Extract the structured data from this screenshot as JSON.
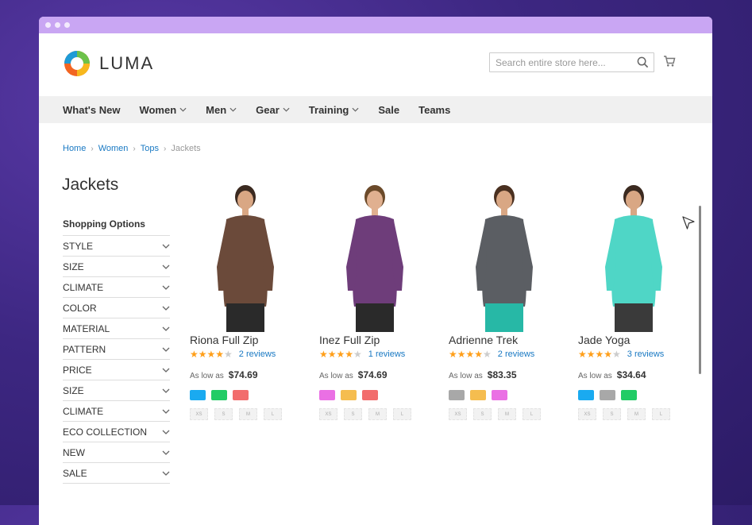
{
  "app": {
    "logo_text": "LUMA"
  },
  "search": {
    "placeholder": "Search entire store here..."
  },
  "nav": [
    {
      "label": "What's New",
      "dropdown": false
    },
    {
      "label": "Women",
      "dropdown": true
    },
    {
      "label": "Men",
      "dropdown": true
    },
    {
      "label": "Gear",
      "dropdown": true
    },
    {
      "label": "Training",
      "dropdown": true
    },
    {
      "label": "Sale",
      "dropdown": false
    },
    {
      "label": "Teams",
      "dropdown": false
    }
  ],
  "breadcrumb": {
    "home": "Home",
    "women": "Women",
    "tops": "Tops",
    "current": "Jackets"
  },
  "page_title": "Jackets",
  "sidebar": {
    "title": "Shopping Options",
    "filters": [
      "STYLE",
      "SIZE",
      "CLIMATE",
      "COLOR",
      "MATERIAL",
      "PATTERN",
      "PRICE",
      "SIZE",
      "CLIMATE",
      "ECO COLLECTION",
      "NEW",
      "SALE"
    ]
  },
  "products": [
    {
      "name": "Riona Full Zip",
      "rating_stars": 4,
      "reviews": "2 reviews",
      "price_label": "As low as",
      "price": "$74.69",
      "swatches": [
        "#1aaaf0",
        "#22cc66",
        "#f26d6d"
      ],
      "sizes": [
        "XS",
        "S",
        "M",
        "L"
      ],
      "top_color": "#6b4a3a",
      "bottom_color": "#2a2a2a",
      "skin": "#d9a784",
      "hair": "#3b2a20"
    },
    {
      "name": "Inez Full Zip",
      "rating_stars": 4,
      "reviews": "1 reviews",
      "price_label": "As low as",
      "price": "$74.69",
      "swatches": [
        "#ea70e4",
        "#f5bd4f",
        "#f26d6d"
      ],
      "sizes": [
        "XS",
        "S",
        "M",
        "L"
      ],
      "top_color": "#6e3d7a",
      "bottom_color": "#2a2a2a",
      "skin": "#e0b090",
      "hair": "#6b4a2a"
    },
    {
      "name": "Adrienne Trek",
      "rating_stars": 4,
      "reviews": "2 reviews",
      "price_label": "As low as",
      "price": "$83.35",
      "swatches": [
        "#a8a8a8",
        "#f5bd4f",
        "#ea70e4"
      ],
      "sizes": [
        "XS",
        "S",
        "M",
        "L"
      ],
      "top_color": "#5b5e63",
      "bottom_color": "#27b8a6",
      "skin": "#d9a784",
      "hair": "#4a3020"
    },
    {
      "name": "Jade Yoga",
      "rating_stars": 4,
      "reviews": "3 reviews",
      "price_label": "As low as",
      "price": "$34.64",
      "swatches": [
        "#1aaaf0",
        "#a8a8a8",
        "#22cc66"
      ],
      "sizes": [
        "XS",
        "S",
        "M",
        "L"
      ],
      "top_color": "#4fd6c6",
      "bottom_color": "#3a3a3a",
      "skin": "#d9a784",
      "hair": "#3b2a20"
    }
  ],
  "icons": {
    "search": "search-icon",
    "cart": "cart-icon",
    "cursor": "cursor-icon"
  },
  "colors": {
    "accent": "#1979c3",
    "star": "#ff9f1a",
    "titlebar": "#c9a6f3"
  }
}
